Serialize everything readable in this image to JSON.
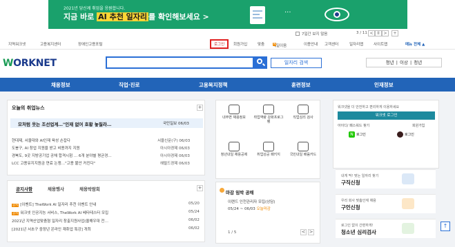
{
  "banner": {
    "line1": "2021년 당신께 취업을 응원합니다.",
    "line2_prefix": "지금 바로 ",
    "line2_highlight": "AI 추천 일자리",
    "line2_suffix": "를 확인해보세요 >",
    "page_indicator": "···"
  },
  "close_bar": {
    "hide_label": "7일간 보지 않음",
    "counter": "3 / 11",
    "prev": "<",
    "pause": "II",
    "next": ">",
    "add": "+"
  },
  "util": {
    "left": [
      "지역워크넷",
      "고용복지센터",
      "장애인고용포털"
    ],
    "login": "로그인",
    "right": [
      "회원가입",
      "맞춤",
      "내일이음",
      "이용안내",
      "고객센터",
      "일자리맵",
      "사이트맵"
    ],
    "new_badge": "N",
    "full_menu": "메뉴 전체 ▲"
  },
  "logo": {
    "w": "W",
    "rest": "ORKNET"
  },
  "search": {
    "placeholder": "",
    "job_search_label": "일자리 검색",
    "keywords": "청년 | 이상 | 청년"
  },
  "nav": [
    "채용정보",
    "직업·진로",
    "고용복지정책",
    "훈련정보",
    "인재정보"
  ],
  "news": {
    "title": "오늘의 취업뉴스",
    "plus": "+",
    "featured": {
      "text": "모처럼 웃는 조선업계…\"인재 없어 호황 놓칠라…",
      "source": "국민일보 06/03"
    },
    "items": [
      {
        "text": "현대제, 서울대와 AI인재 육성 손잡다",
        "source": "서울신문(구) 06/03"
      },
      {
        "text": "도봉구, AI 창업 지원을 받고 비용까지 지원",
        "source": "아시아경제 06/03"
      },
      {
        "text": "경북도, 9곳 지방공기업 공채 합격시험 ... 6개 분야별 평균경…",
        "source": "아시아경제 06/03"
      },
      {
        "text": "LCC 고용유지지원금 연료 논쟁…\"고용 불안 커진다\"",
        "source": "헤럴드경제 06/03"
      }
    ]
  },
  "notice": {
    "tabs": [
      "공지사항",
      "채용행사",
      "채용박람회"
    ],
    "plus": "+",
    "items": [
      {
        "tag": "공지",
        "text": "[이벤트] TheWork AI 일자리 추천 이벤트 안내",
        "date": "05/20"
      },
      {
        "tag": "공지",
        "text": "워크넷 인공지능 서비스, TheWork AI 베타테스터 모집",
        "date": "05/24"
      },
      {
        "tag": "",
        "text": "2021년 지역산업맞춤형 일자리 창출지원사업(올해우대 전…",
        "date": "06/02"
      },
      {
        "tag": "",
        "text": "[2021년 서초구 중장년 온라인 재취업 특강] 개최",
        "date": "06/02"
      }
    ]
  },
  "services": [
    "내주변 채용정보",
    "취업역량 강화프로그램",
    "직업심리 검사",
    "청년내일 채용공제",
    "취업성공 패키지",
    "국민내일 배움카드"
  ],
  "deadline": {
    "title": "마감 임박 공채",
    "company": "이랜드  인천관리자 모집(상담)",
    "period": "05/24 ~ 06/03",
    "badge": "오늘마감",
    "pager": "1 / 5",
    "prev": "<",
    "next": ">"
  },
  "login": {
    "hint": "워크넷을 더 안전하고 편리하게 이용하세요",
    "button": "워크넷 로그인",
    "find": "아이디/ 패스워드 찾기",
    "join": "회원가입",
    "naver": "로그인",
    "kakao": "로그인",
    "naver_letter": "N"
  },
  "cards": [
    {
      "small": "내게 딱! 맞는 일자리 찾기",
      "large": "구직신청"
    },
    {
      "small": "우리 회사 맞춤인재 채용",
      "large": "구인신청"
    },
    {
      "small": "로그인 없이 간편하게!",
      "large": "청소년 심리검사"
    }
  ],
  "to_top": "↑",
  "colors": {
    "banner": "#1aa16c",
    "nav": "#2264b8",
    "accent": "#2a6fd6",
    "login_btn": "#1d8a9e",
    "highlight": "#fcd535"
  }
}
